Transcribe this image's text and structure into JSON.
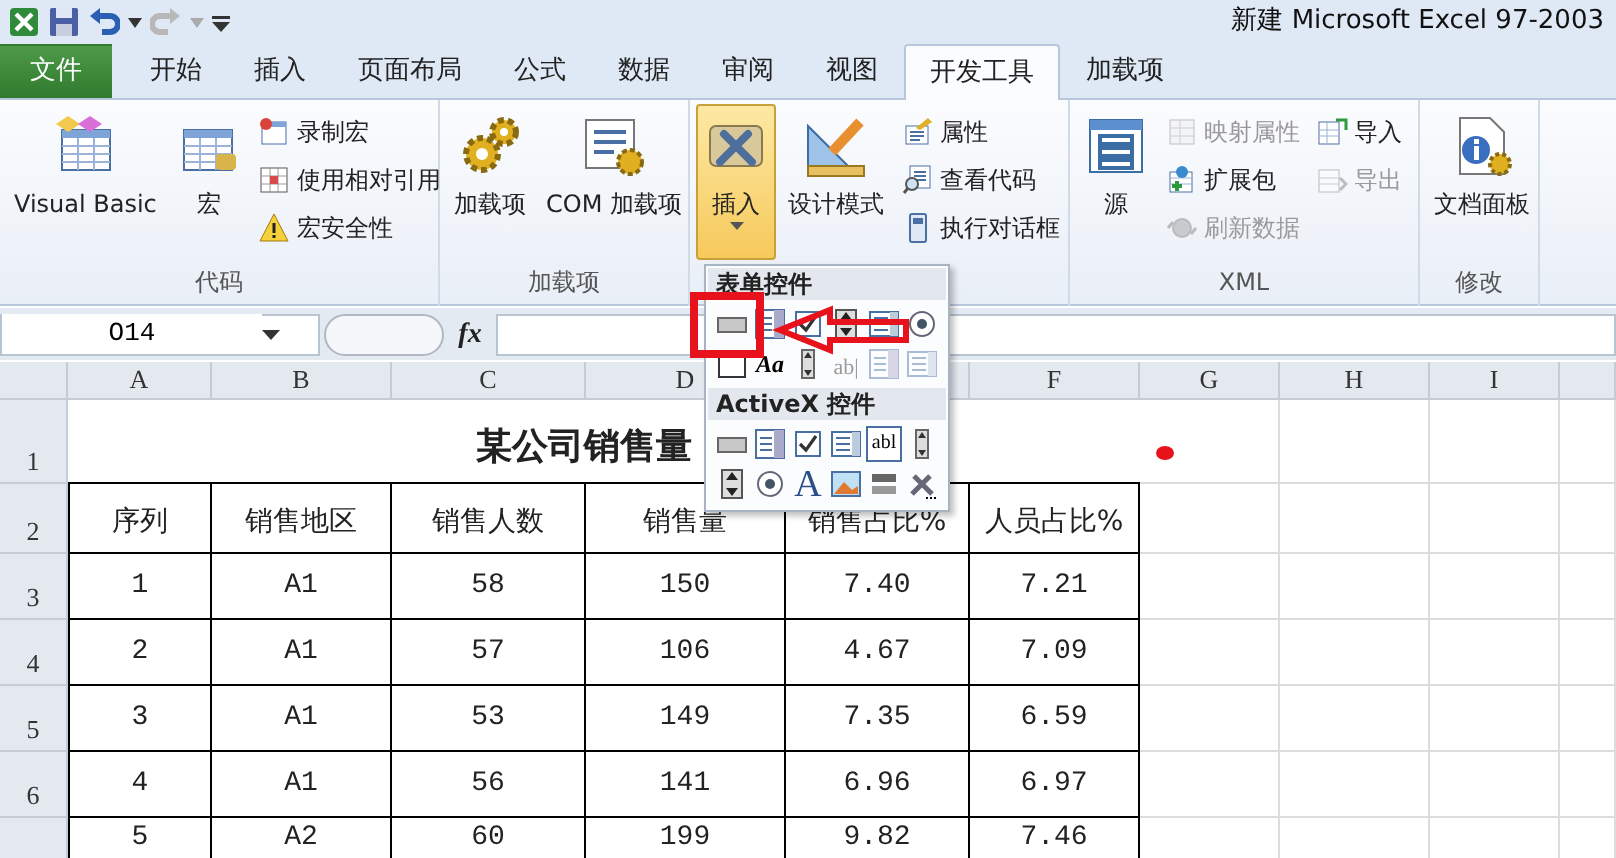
{
  "title_bar": {
    "title": "新建 Microsoft Excel 97-2003"
  },
  "tabs": [
    {
      "label": "文件",
      "kind": "file",
      "selected": false
    },
    {
      "label": "开始",
      "kind": "tab",
      "selected": false
    },
    {
      "label": "插入",
      "kind": "tab",
      "selected": false
    },
    {
      "label": "页面布局",
      "kind": "tab",
      "selected": false
    },
    {
      "label": "公式",
      "kind": "tab",
      "selected": false
    },
    {
      "label": "数据",
      "kind": "tab",
      "selected": false
    },
    {
      "label": "审阅",
      "kind": "tab",
      "selected": false
    },
    {
      "label": "视图",
      "kind": "tab",
      "selected": false
    },
    {
      "label": "开发工具",
      "kind": "tab",
      "selected": true
    },
    {
      "label": "加载项",
      "kind": "tab",
      "selected": false
    }
  ],
  "ribbon_groups": [
    {
      "label": "代码",
      "items": [
        {
          "label": "Visual Basic",
          "kind": "large",
          "pressed": false,
          "disabled": false
        },
        {
          "label": "宏",
          "kind": "large",
          "pressed": false,
          "disabled": false
        },
        {
          "label": "录制宏",
          "kind": "small",
          "pressed": false,
          "disabled": false
        },
        {
          "label": "使用相对引用",
          "kind": "small",
          "pressed": false,
          "disabled": false
        },
        {
          "label": "宏安全性",
          "kind": "small",
          "pressed": false,
          "disabled": false
        }
      ]
    },
    {
      "label": "加载项",
      "items": [
        {
          "label": "加载项",
          "kind": "large",
          "pressed": false,
          "disabled": false
        },
        {
          "label": "COM 加载项",
          "kind": "large",
          "pressed": false,
          "disabled": false
        }
      ]
    },
    {
      "items": [
        {
          "label": "插入",
          "kind": "large-menu",
          "pressed": true,
          "disabled": false
        },
        {
          "label": "设计模式",
          "kind": "large",
          "pressed": false,
          "disabled": false
        },
        {
          "label": "属性",
          "kind": "small",
          "pressed": false,
          "disabled": false
        },
        {
          "label": "查看代码",
          "kind": "small",
          "pressed": false,
          "disabled": false
        },
        {
          "label": "执行对话框",
          "kind": "small",
          "pressed": false,
          "disabled": false
        }
      ]
    },
    {
      "label": "XML",
      "items": [
        {
          "label": "源",
          "kind": "large",
          "pressed": false,
          "disabled": false
        },
        {
          "label": "映射属性",
          "kind": "small",
          "pressed": false,
          "disabled": true
        },
        {
          "label": "扩展包",
          "kind": "small",
          "pressed": false,
          "disabled": false
        },
        {
          "label": "刷新数据",
          "kind": "small",
          "pressed": false,
          "disabled": true
        },
        {
          "label": "导入",
          "kind": "small",
          "pressed": false,
          "disabled": false
        },
        {
          "label": "导出",
          "kind": "small",
          "pressed": false,
          "disabled": true
        }
      ]
    },
    {
      "label": "修改",
      "items": [
        {
          "label": "文档面板",
          "kind": "large",
          "pressed": false,
          "disabled": false
        }
      ]
    }
  ],
  "formula_bar": {
    "name_box": "O14",
    "function_label": "fx"
  },
  "column_headers": [
    {
      "kind": "letter",
      "label": "A"
    },
    {
      "kind": "letter",
      "label": "B"
    },
    {
      "kind": "letter",
      "label": "C"
    },
    {
      "kind": "letter",
      "label": "D"
    },
    {
      "kind": "covered"
    },
    {
      "kind": "letter",
      "label": "F"
    },
    {
      "kind": "letter",
      "label": "G"
    },
    {
      "kind": "letter",
      "label": "H"
    },
    {
      "kind": "letter",
      "label": "I"
    }
  ],
  "row_headers": [
    "1",
    "2",
    "3",
    "4",
    "5",
    "6"
  ],
  "table": {
    "title": "某公司销售量",
    "headers": [
      "序列",
      "销售地区",
      "销售人数",
      "销售量",
      "销售占比%",
      "人员占比%"
    ],
    "rows": [
      [
        "1",
        "A1",
        "58",
        "150",
        "7.40",
        "7.21"
      ],
      [
        "2",
        "A1",
        "57",
        "106",
        "4.67",
        "7.09"
      ],
      [
        "3",
        "A1",
        "53",
        "149",
        "7.35",
        "6.59"
      ],
      [
        "4",
        "A1",
        "56",
        "141",
        "6.96",
        "6.97"
      ],
      [
        "5",
        "A2",
        "60",
        "199",
        "9.82",
        "7.46"
      ]
    ]
  },
  "controls_menu": {
    "sections": [
      {
        "title": "表单控件",
        "controls": [
          {
            "kind": "button",
            "disabled": false
          },
          {
            "kind": "combo",
            "disabled": false
          },
          {
            "kind": "check",
            "disabled": false
          },
          {
            "kind": "spin",
            "disabled": false
          },
          {
            "kind": "list",
            "disabled": false
          },
          {
            "kind": "option",
            "disabled": false
          },
          {
            "kind": "groupbox",
            "disabled": false
          },
          {
            "kind": "label",
            "text": "Aa",
            "disabled": false
          },
          {
            "kind": "scroll",
            "disabled": false
          },
          {
            "kind": "textbox",
            "text": "ab|",
            "disabled": true
          },
          {
            "kind": "combo",
            "disabled": true
          },
          {
            "kind": "list",
            "disabled": true
          }
        ]
      },
      {
        "title": "ActiveX 控件",
        "controls": [
          {
            "kind": "button",
            "disabled": false
          },
          {
            "kind": "combo",
            "disabled": false
          },
          {
            "kind": "check",
            "disabled": false
          },
          {
            "kind": "list",
            "disabled": false
          },
          {
            "kind": "boxed-text",
            "text": "abl",
            "disabled": false
          },
          {
            "kind": "scroll",
            "disabled": false
          },
          {
            "kind": "spin",
            "disabled": false
          },
          {
            "kind": "option",
            "disabled": false
          },
          {
            "kind": "big-label",
            "text": "A",
            "disabled": false
          },
          {
            "kind": "image",
            "disabled": false
          },
          {
            "kind": "toggle",
            "disabled": false
          },
          {
            "kind": "more",
            "disabled": false
          }
        ]
      }
    ]
  }
}
